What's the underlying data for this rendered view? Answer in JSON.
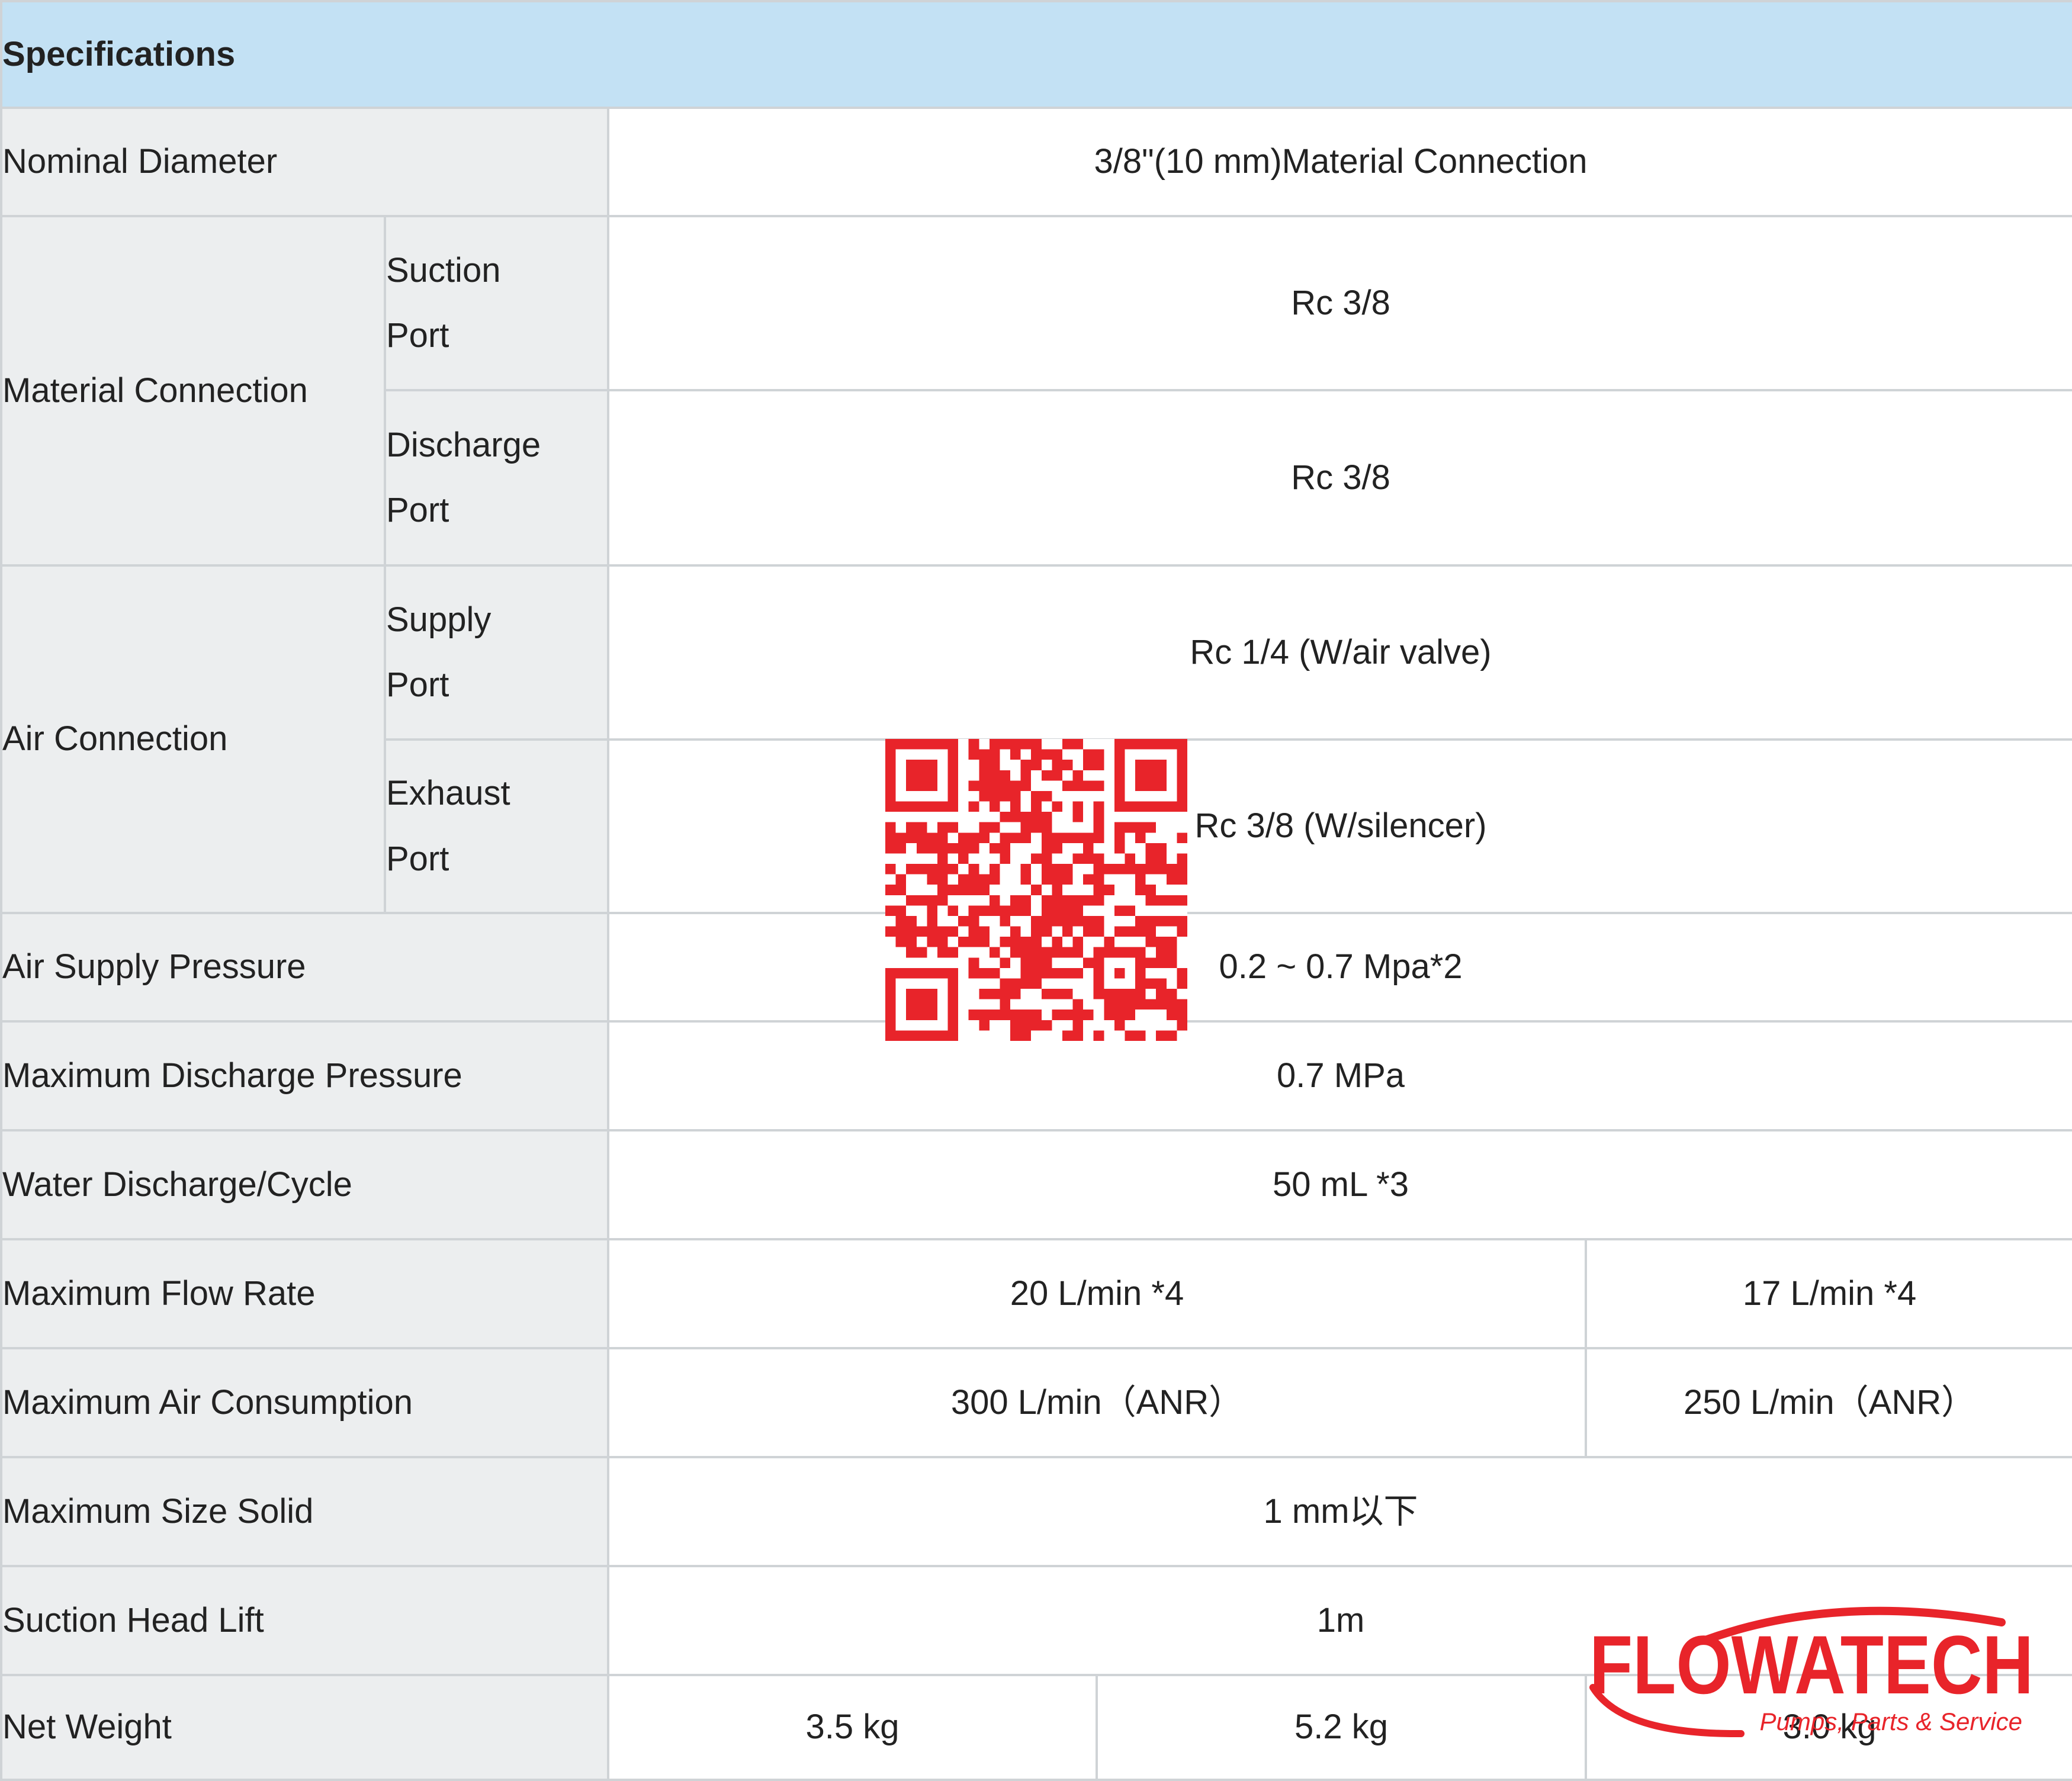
{
  "header": {
    "title": "Specifications"
  },
  "rows": {
    "nominal_diameter": {
      "label": "Nominal Diameter",
      "value": "3/8\"(10 mm)Material Connection"
    },
    "material_connection": {
      "label": "Material Connection",
      "suction": {
        "label_1": "Suction",
        "label_2": "Port",
        "value": "Rc 3/8"
      },
      "discharge": {
        "label_1": "Discharge",
        "label_2": "Port",
        "value": "Rc 3/8"
      }
    },
    "air_connection": {
      "label": "Air Connection",
      "supply": {
        "label_1": "Supply",
        "label_2": "Port",
        "value": "Rc 1/4 (W/air valve)"
      },
      "exhaust": {
        "label_1": "Exhaust",
        "label_2": "Port",
        "value": "Rc 3/8 (W/silencer)"
      }
    },
    "air_supply_pressure": {
      "label": "Air Supply Pressure",
      "value": "0.2 ~ 0.7 Mpa*2"
    },
    "max_discharge_pressure": {
      "label": "Maximum Discharge Pressure",
      "value": "0.7 MPa"
    },
    "water_discharge_cycle": {
      "label": "Water Discharge/Cycle",
      "value": "50 mL *3"
    },
    "max_flow_rate": {
      "label": "Maximum Flow Rate",
      "value_1": "20 L/min *4",
      "value_2": "17 L/min *4"
    },
    "max_air_consumption": {
      "label": "Maximum Air Consumption",
      "value_1": "300 L/min（ANR）",
      "value_2": "250 L/min（ANR）"
    },
    "max_size_solid": {
      "label": "Maximum Size Solid",
      "value": "1 mm以下"
    },
    "suction_head_lift": {
      "label": "Suction Head Lift",
      "value": "1m"
    },
    "net_weight": {
      "label": "Net Weight",
      "value_1": "3.5 kg",
      "value_2": "5.2 kg",
      "value_3": "3.0 kg"
    }
  },
  "logo": {
    "name": "FLOWATECH",
    "tagline": "Pumps, Parts & Service"
  },
  "colors": {
    "header_bg": "#c3e1f4",
    "label_bg": "#eceeef",
    "border": "#cfd3d6",
    "brand_red": "#e8242a"
  },
  "icons": [
    "qr-code-icon",
    "flowatech-logo"
  ]
}
